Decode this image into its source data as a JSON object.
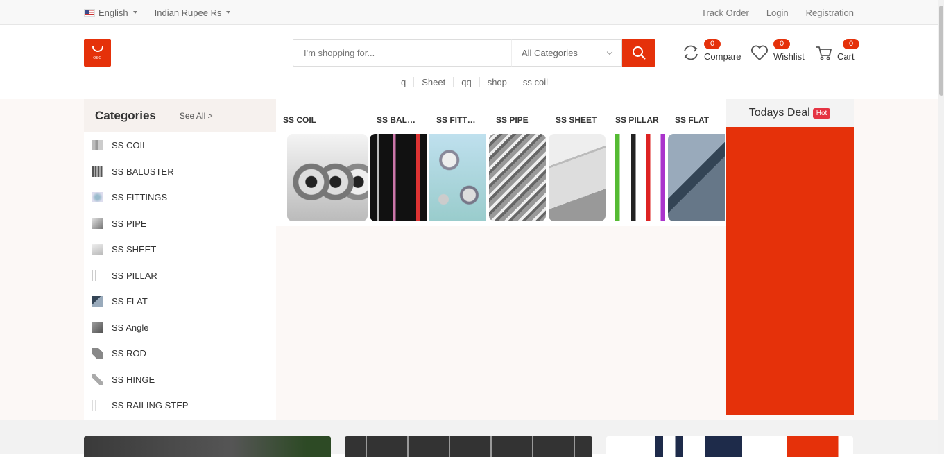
{
  "topbar": {
    "language": "English",
    "currency": "Indian Rupee Rs",
    "links": [
      "Track Order",
      "Login",
      "Registration"
    ]
  },
  "header": {
    "logo_text": "OSO",
    "search_placeholder": "I'm shopping for...",
    "category_select": "All Categories",
    "suggestions": [
      "q",
      "Sheet",
      "qq",
      "shop",
      "ss coil"
    ],
    "compare": {
      "label": "Compare",
      "count": "0"
    },
    "wishlist": {
      "label": "Wishlist",
      "count": "0"
    },
    "cart": {
      "label": "Cart",
      "count": "0"
    }
  },
  "categories": {
    "title": "Categories",
    "see_all": "See All >",
    "items": [
      "SS COIL",
      "SS BALUSTER",
      "SS FITTINGS",
      "SS PIPE",
      "SS SHEET",
      "SS PILLAR",
      "SS FLAT",
      "SS Angle",
      "SS ROD",
      "SS HINGE",
      "SS RAILING STEP"
    ]
  },
  "featured": {
    "tabs": [
      "SS COIL",
      "SS BALUSTER",
      "SS FITTINGS",
      "SS PIPE",
      "SS SHEET",
      "SS PILLAR",
      "SS FLAT"
    ]
  },
  "deal": {
    "title": "Todays Deal",
    "badge": "Hot"
  },
  "colors": {
    "accent": "#e5310a",
    "hot_badge": "#e53342"
  }
}
